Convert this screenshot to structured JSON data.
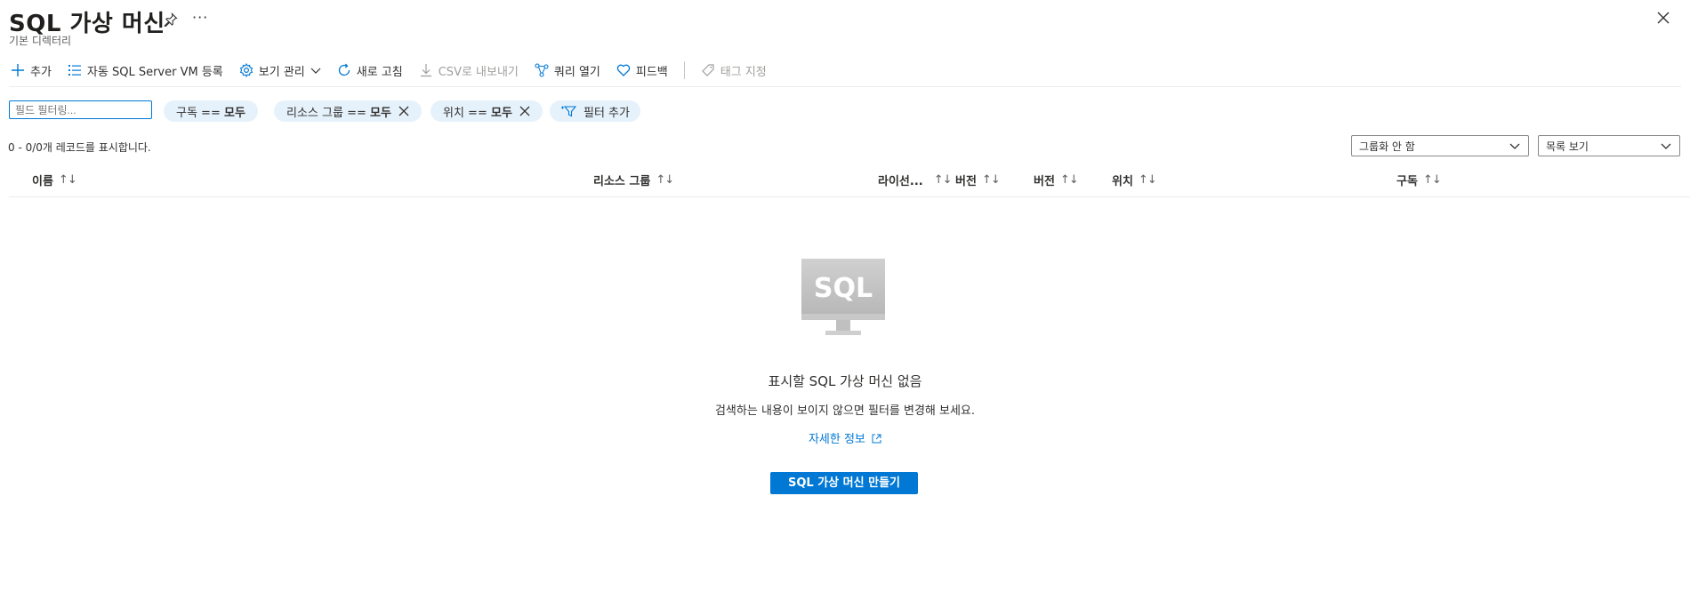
{
  "header": {
    "title": "SQL 가상 머신",
    "subtitle": "기본 디렉터리",
    "more_label": "···"
  },
  "toolbar": {
    "items": [
      {
        "label": "추가",
        "icon": "plus-icon"
      },
      {
        "label": "자동 SQL Server VM 등록",
        "icon": "list-icon"
      },
      {
        "label": "보기 관리",
        "icon": "gear-icon"
      },
      {
        "label": "새로 고침",
        "icon": "refresh-icon"
      },
      {
        "label": "CSV로 내보내기",
        "icon": "download-icon",
        "disabled": true
      },
      {
        "label": "쿼리 열기",
        "icon": "query-icon"
      },
      {
        "label": "피드백",
        "icon": "heart-icon"
      },
      {
        "label": "태그 지정",
        "icon": "tag-icon",
        "disabled": true
      }
    ]
  },
  "filters": {
    "placeholder": "필드 필터링...",
    "pills": [
      {
        "name": "구독 ==",
        "value": "모두"
      },
      {
        "name": "리소스 그룹 ==",
        "value": "모두"
      },
      {
        "name": "위치 ==",
        "value": "모두"
      }
    ],
    "add_filter": "필터 추가"
  },
  "records": {
    "summary": "0 - 0/0개 레코드를 표시합니다.",
    "grouping": "그룹화 안 함",
    "view": "목록 보기"
  },
  "table": {
    "columns": [
      "이름",
      "리소스 그룹",
      "라이선...",
      "버전",
      "버전",
      "위치",
      "구독"
    ],
    "sort_glyph": "↑↓"
  },
  "empty": {
    "icon_text": "SQL",
    "title": "표시할 SQL 가상 머신 없음",
    "description": "검색하는 내용이 보이지 않으면 필터를 변경해 보세요.",
    "learn_more": "자세한 정보",
    "create_button": "SQL 가상 머신 만들기"
  },
  "colors": {
    "accent": "#0078d4",
    "pill_bg": "#e6f2fb",
    "disabled": "#a19f9d"
  }
}
